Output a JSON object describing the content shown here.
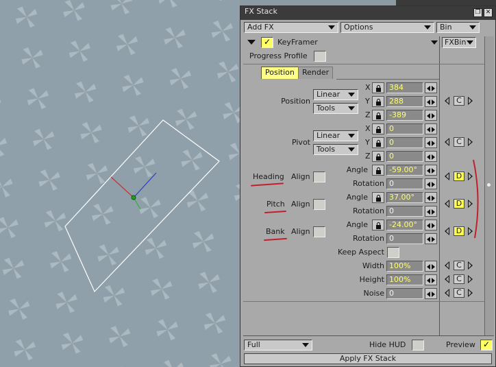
{
  "window": {
    "title": "FX Stack"
  },
  "toolbar": {
    "add_fx": "Add FX",
    "options": "Options",
    "bin": "Bin"
  },
  "effect": {
    "name": "KeyFramer",
    "enabled": true,
    "bin_label": "FXBin"
  },
  "progress_profile_label": "Progress Profile",
  "tabs": [
    "Position",
    "Render"
  ],
  "active_tab": "Position",
  "position": {
    "label": "Position",
    "mode": "Linear",
    "tools": "Tools",
    "x_label": "X",
    "y_label": "Y",
    "z_label": "Z",
    "x": "384",
    "y": "288",
    "z": "-389",
    "key": "C"
  },
  "pivot": {
    "label": "Pivot",
    "mode": "Linear",
    "tools": "Tools",
    "x_label": "X",
    "y_label": "Y",
    "z_label": "Z",
    "x": "0",
    "y": "0",
    "z": "0",
    "key": "C"
  },
  "rotation": [
    {
      "label": "Heading",
      "align_label": "Align",
      "angle_label": "Angle",
      "angle": "-59.00°",
      "rotation_label": "Rotation",
      "rotation": "0",
      "key": "D"
    },
    {
      "label": "Pitch",
      "align_label": "Align",
      "angle_label": "Angle",
      "angle": "37.00°",
      "rotation_label": "Rotation",
      "rotation": "0",
      "key": "D"
    },
    {
      "label": "Bank",
      "align_label": "Align",
      "angle_label": "Angle",
      "angle": "-24.00°",
      "rotation_label": "Rotation",
      "rotation": "0",
      "key": "D"
    }
  ],
  "keep_aspect_label": "Keep Aspect",
  "size": [
    {
      "label": "Width",
      "value": "100%",
      "key": "C"
    },
    {
      "label": "Height",
      "value": "100%",
      "key": "C"
    },
    {
      "label": "Noise",
      "value": "0",
      "key": "C"
    }
  ],
  "footer": {
    "quality": "Full",
    "hide_hud_label": "Hide HUD",
    "preview_label": "Preview",
    "preview_checked": true,
    "apply_label": "Apply FX Stack"
  },
  "colors": {
    "field_text": "#ffff70",
    "key_active": "#ffff55",
    "annotation": "#c0202a",
    "titlebar": "#3b3b3b"
  }
}
